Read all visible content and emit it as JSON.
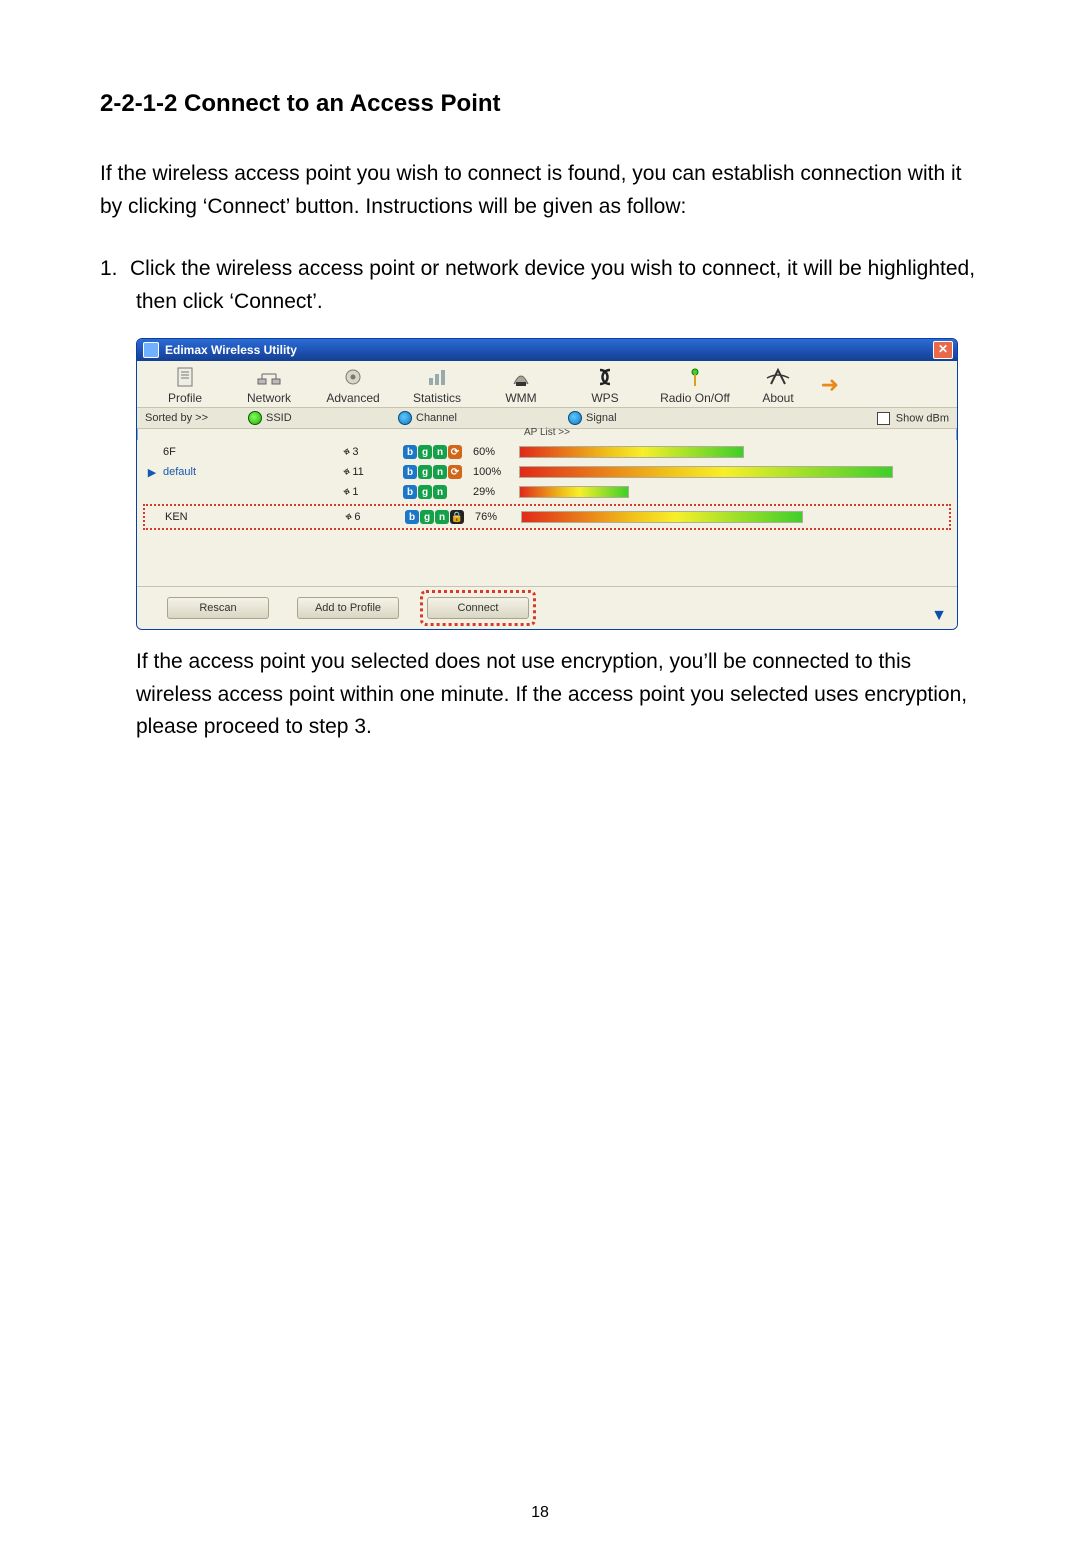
{
  "heading": "2-2-1-2 Connect to an Access Point",
  "intro": "If the wireless access point you wish to connect is found, you can establish connection with it by clicking ‘Connect’ button. Instructions will be given as follow:",
  "step1_num": "1.",
  "step1": "Click the wireless access point or network device you wish to connect, it will be highlighted, then click ‘Connect’.",
  "followup": "If the access point you selected does not use encryption, you’ll be connected to this wireless access point within one minute. If the access point you selected uses encryption, please proceed to step 3.",
  "page_num": "18",
  "window": {
    "title": "Edimax Wireless Utility",
    "tabs": {
      "profile": "Profile",
      "network": "Network",
      "advanced": "Advanced",
      "statistics": "Statistics",
      "wmm": "WMM",
      "wps": "WPS",
      "radio": "Radio On/Off",
      "about": "About"
    },
    "sort": {
      "sorted_by": "Sorted by >>",
      "ssid": "SSID",
      "channel": "Channel",
      "signal": "Signal",
      "ap_list": "AP List >>",
      "show_dbm": "Show dBm"
    },
    "rows": [
      {
        "ssid": "6F",
        "channel": "3",
        "modes": [
          "b",
          "g",
          "n",
          "l"
        ],
        "pct": "60%",
        "bar": 60,
        "connected": false,
        "selected": false
      },
      {
        "ssid": "default",
        "channel": "11",
        "modes": [
          "b",
          "g",
          "n",
          "l"
        ],
        "pct": "100%",
        "bar": 100,
        "connected": true,
        "selected": false
      },
      {
        "ssid": "",
        "channel": "1",
        "modes": [
          "b",
          "g",
          "n"
        ],
        "pct": "29%",
        "bar": 29,
        "connected": false,
        "selected": false
      },
      {
        "ssid": "KEN",
        "channel": "6",
        "modes": [
          "b",
          "g",
          "n",
          "k"
        ],
        "pct": "76%",
        "bar": 76,
        "connected": false,
        "selected": true
      }
    ],
    "buttons": {
      "rescan": "Rescan",
      "add_profile": "Add to Profile",
      "connect": "Connect"
    }
  }
}
